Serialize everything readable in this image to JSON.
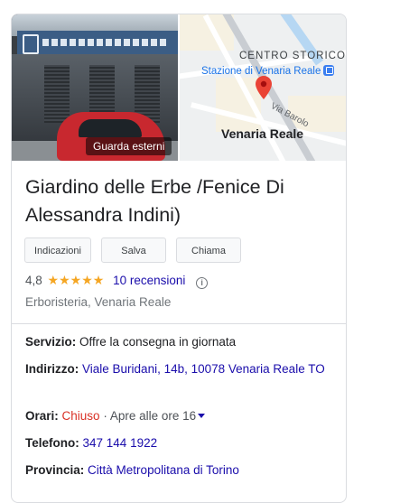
{
  "photo": {
    "chip_label": "Guarda esterni"
  },
  "map": {
    "district_label": "CENTRO STORICO",
    "station_label": "Stazione di Venaria Reale",
    "street_label": "Via Barolo",
    "town_label": "Venaria Reale"
  },
  "place": {
    "name": "Giardino delle Erbe /Fenice Di Alessandra Indini)",
    "rating": "4,8",
    "stars": "★★★★★",
    "reviews": "10 recensioni",
    "category": "Erboristeria, Venaria Reale"
  },
  "actions": {
    "directions": "Indicazioni",
    "save": "Salva",
    "call": "Chiama"
  },
  "details": {
    "service_label": "Servizio:",
    "service_value": "Offre la consegna in giornata",
    "address_label": "Indirizzo:",
    "address_value": "Viale Buridani, 14b, 10078 Venaria Reale TO",
    "hours_label": "Orari:",
    "hours_status": "Chiuso",
    "hours_next": " · Apre alle ore 16",
    "phone_label": "Telefono:",
    "phone_value": "347 144 1922",
    "province_label": "Provincia:",
    "province_value": "Città Metropolitana di Torino"
  },
  "colors": {
    "link": "#1a0dab",
    "closed": "#d93025",
    "star": "#f5a623",
    "pin": "#ea4335",
    "station": "#3b7ff0"
  }
}
